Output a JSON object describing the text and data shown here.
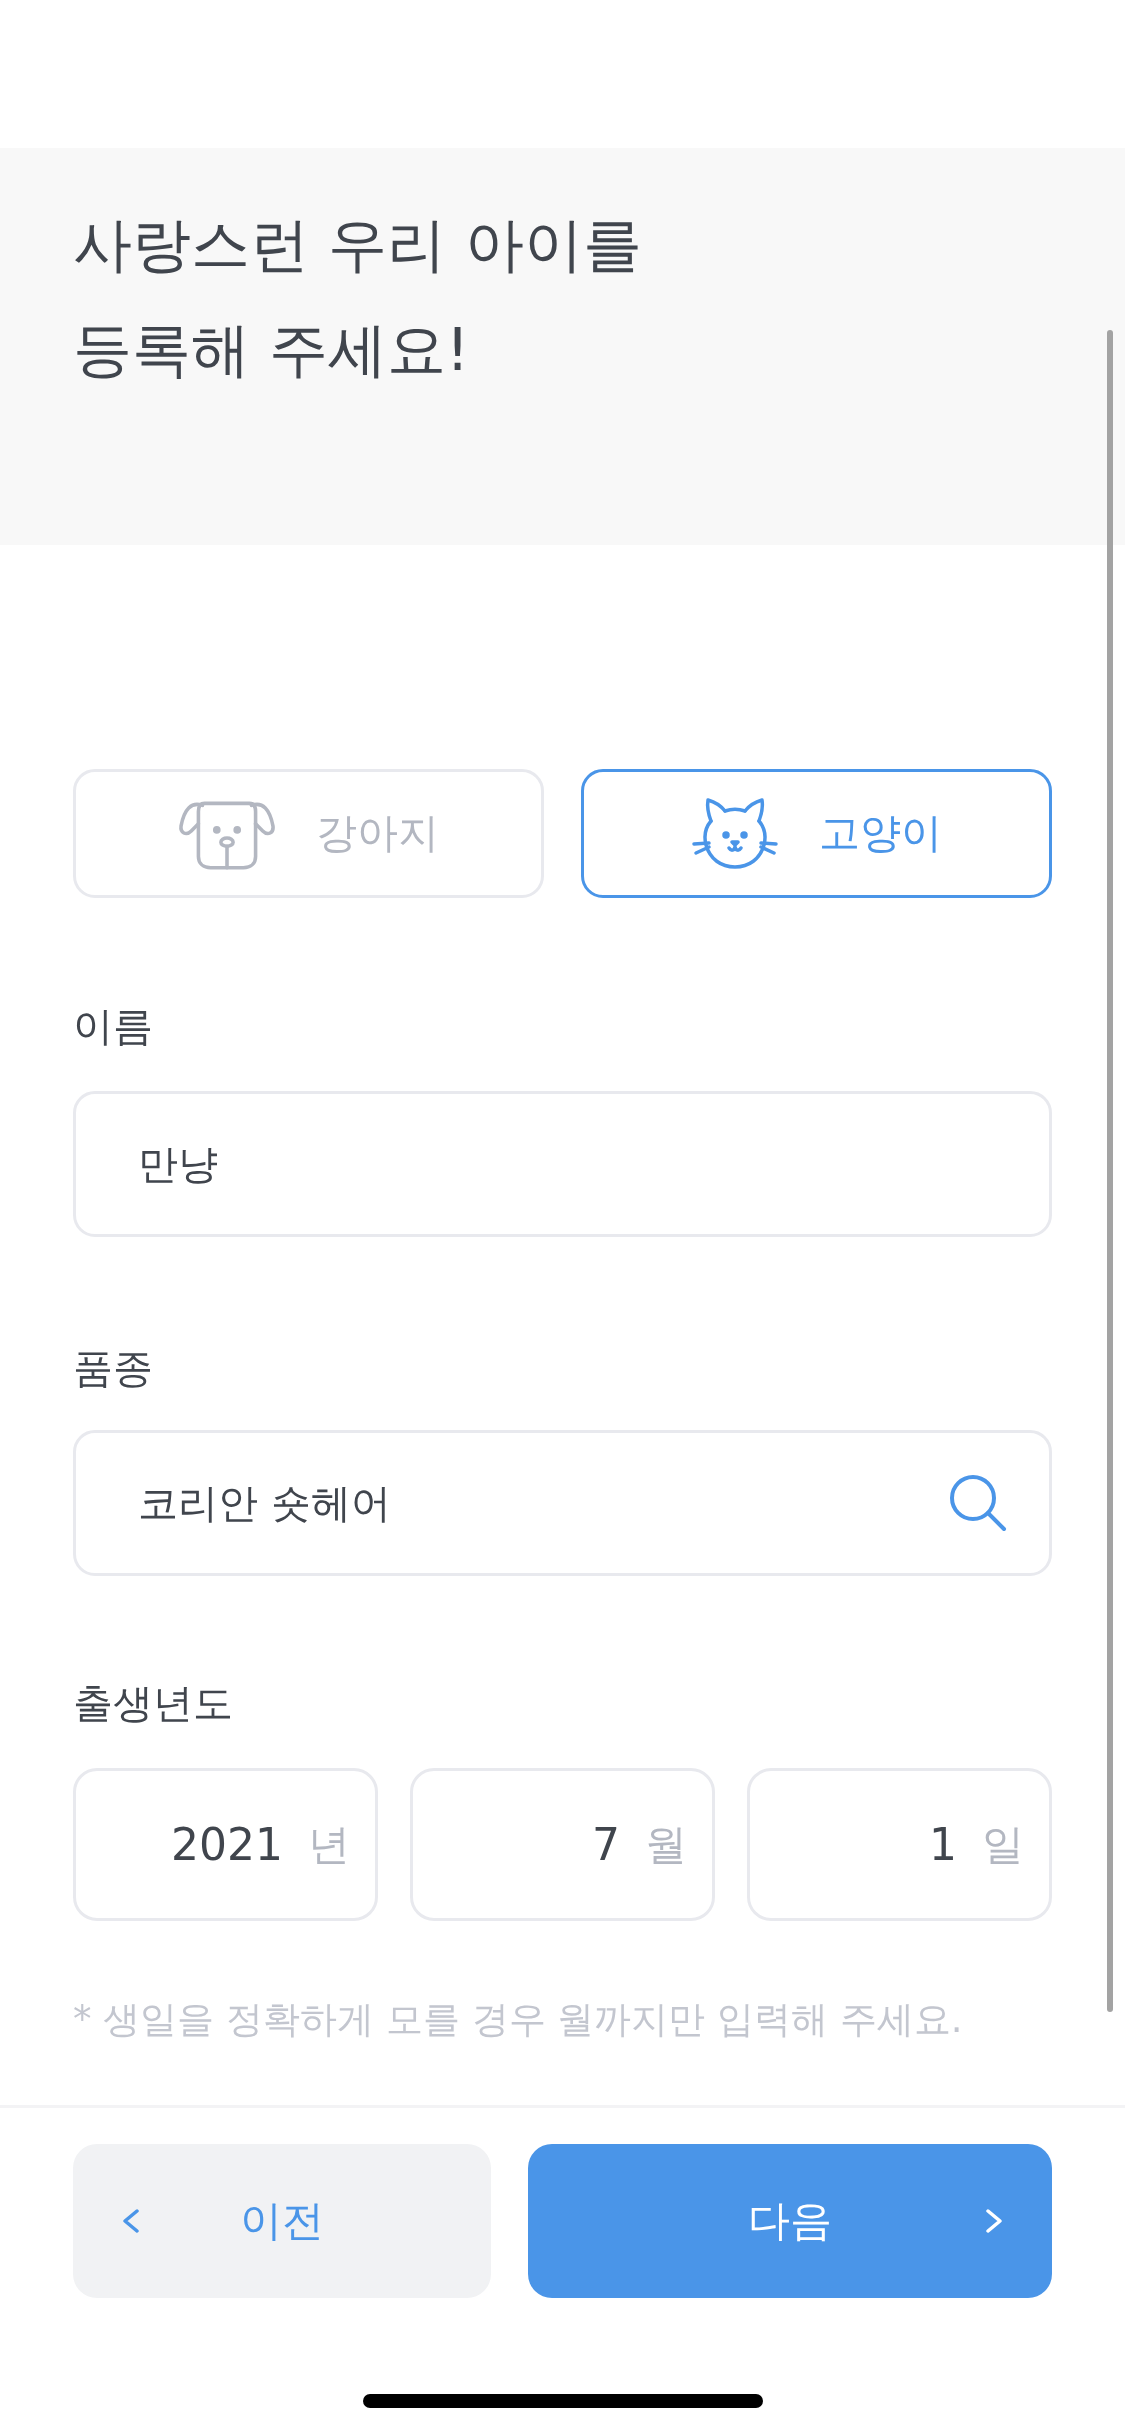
{
  "header": {
    "title_lines": [
      "사랑스런 우리 아이를",
      "등록해 주세요!"
    ]
  },
  "pet_types": [
    {
      "kind": "dog",
      "label": "강아지",
      "selected": false
    },
    {
      "kind": "cat",
      "label": "고양이",
      "selected": true
    }
  ],
  "fields": [
    {
      "kind": "text",
      "label": "이름",
      "value": "만냥"
    },
    {
      "kind": "search",
      "label": "품종",
      "value": "코리안 숏헤어"
    }
  ],
  "birth": {
    "label": "출생년도",
    "parts": [
      {
        "value": "2021",
        "unit": "년"
      },
      {
        "value": "7",
        "unit": "월"
      },
      {
        "value": "1",
        "unit": "일"
      }
    ],
    "hint": "* 생일을 정확하게 모를 경우 월까지만 입력해 주세요."
  },
  "footer": {
    "buttons": [
      {
        "kind": "prev",
        "label": "이전"
      },
      {
        "kind": "next",
        "label": "다음"
      }
    ]
  }
}
